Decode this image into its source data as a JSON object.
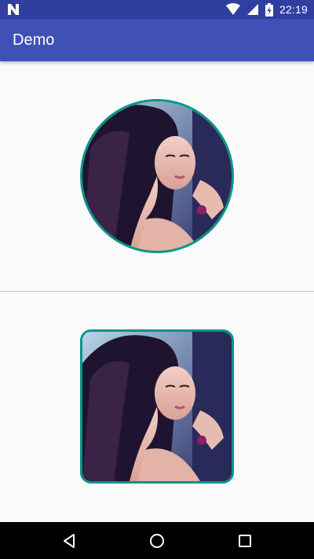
{
  "status_bar": {
    "time": "22:19",
    "notification_icon": "n-icon",
    "wifi_icon": "wifi-icon",
    "signal_icon": "signal-icon",
    "battery_icon": "battery-charging-icon",
    "background_color": "#303f9f"
  },
  "app_bar": {
    "title": "Demo",
    "background_color": "#3f51b5"
  },
  "content": {
    "image_border_color": "#009688",
    "images": [
      {
        "shape": "circle",
        "description_icon": "portrait-photo"
      },
      {
        "shape": "rounded-square",
        "description_icon": "portrait-photo"
      }
    ]
  },
  "nav_bar": {
    "back_icon": "back-triangle-icon",
    "home_icon": "home-circle-icon",
    "recents_icon": "recents-square-icon"
  }
}
